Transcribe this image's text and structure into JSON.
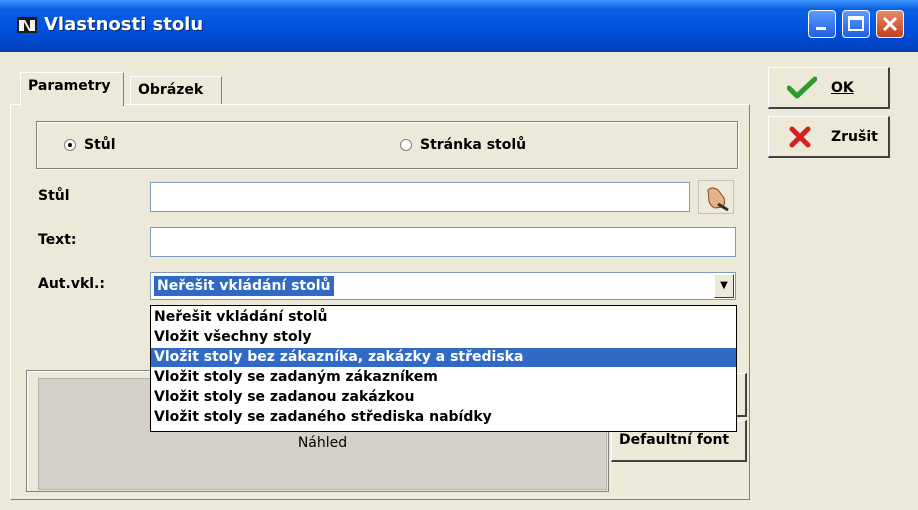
{
  "window": {
    "title": "Vlastnosti stolu",
    "colors": {
      "titlebar": "#0054e3",
      "selection": "#316ac5",
      "face": "#ece9d8",
      "ok_check": "#2e9b2e",
      "cancel_x": "#d42020"
    }
  },
  "tabs": [
    {
      "label": "Parametry",
      "active": true
    },
    {
      "label": "Obrázek",
      "active": false
    }
  ],
  "radios": [
    {
      "label": "Stůl",
      "checked": true
    },
    {
      "label": "Stránka stolů",
      "checked": false
    }
  ],
  "form": {
    "table_label": "Stůl",
    "table_value": "",
    "text_label": "Text:",
    "text_value": "",
    "autoinsert_label": "Aut.vkl.:",
    "autoinsert_value": "Neřešit vkládání stolů"
  },
  "dropdown": {
    "options": [
      "Neřešit vkládání stolů",
      "Vložit všechny stoly",
      "Vložit stoly bez zákazníka, zakázky a střediska",
      "Vložit stoly se zadaným zákazníkem",
      "Vložit stoly se zadanou zakázkou",
      "Vložit stoly se zadaného střediska nabídky"
    ],
    "selected_index": 2
  },
  "preview": {
    "label": "Náhled",
    "default_font_button": "Defaultní font"
  },
  "buttons": {
    "ok": "OK",
    "cancel": "Zrušit"
  }
}
